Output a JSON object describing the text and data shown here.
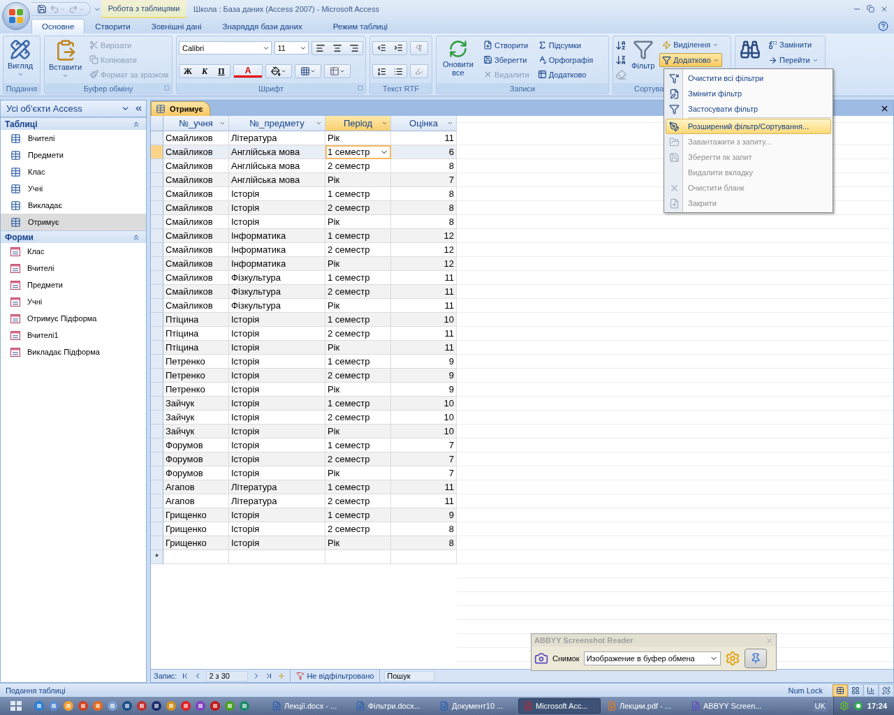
{
  "window": {
    "title": "Школа : База даних (Access 2007)  -  Microsoft Access",
    "context_group": "Робота з таблицями"
  },
  "ribbon_tabs": [
    {
      "label": "Основне",
      "selected": true,
      "kind": "main"
    },
    {
      "label": "Створити",
      "selected": false,
      "kind": "main"
    },
    {
      "label": "Зовнішні дані",
      "selected": false,
      "kind": "main"
    },
    {
      "label": "Знаряддя бази даних",
      "selected": false,
      "kind": "main"
    },
    {
      "label": "Режим таблиці",
      "selected": false,
      "kind": "context"
    }
  ],
  "ribbon": {
    "view": {
      "label": "Подання",
      "button": "Вигляд"
    },
    "clipboard": {
      "label": "Буфер обміну",
      "paste": "Вставити",
      "items": [
        {
          "label": "Вирізати",
          "disabled": true
        },
        {
          "label": "Копіювати",
          "disabled": true
        },
        {
          "label": "Формат за зразком",
          "disabled": true
        }
      ]
    },
    "font": {
      "label": "Шрифт",
      "font_name": "Calibri",
      "font_size": "11",
      "bold": "Ж",
      "italic": "К",
      "underline": "П",
      "font_color": "A"
    },
    "rtf": {
      "label": "Текст RTF"
    },
    "records": {
      "label": "Записи",
      "refresh": "Оновити все",
      "items": [
        {
          "label": "Створити",
          "disabled": false
        },
        {
          "label": "Зберегти",
          "disabled": false
        },
        {
          "label": "Видалити",
          "disabled": true
        },
        {
          "label": "Підсумки",
          "disabled": false
        },
        {
          "label": "Орфографія",
          "disabled": false
        },
        {
          "label": "Додатково",
          "disabled": false
        }
      ]
    },
    "sort_filter": {
      "label": "Сортува",
      "filter": "Фільтр",
      "items": [
        {
          "label": "Виділення",
          "selected": false
        },
        {
          "label": "Додатково",
          "selected": true
        }
      ]
    },
    "find": {
      "items": [
        "Замінити",
        "Перейти"
      ]
    }
  },
  "advanced_menu": [
    {
      "label": "Очистити всі фільтри",
      "disabled": false,
      "selected": false
    },
    {
      "label": "Змінити фільтр",
      "disabled": false,
      "selected": false
    },
    {
      "label": "Застосувати фільтр",
      "disabled": false,
      "selected": false
    },
    {
      "label": "Розширений фільтр/Сортування...",
      "disabled": false,
      "selected": true
    },
    {
      "label": "Завантажити з запиту...",
      "disabled": true,
      "selected": false
    },
    {
      "label": "Зберегти як запит",
      "disabled": true,
      "selected": false
    },
    {
      "label": "Видалити вкладку",
      "disabled": true,
      "selected": false
    },
    {
      "label": "Очистити бланк",
      "disabled": true,
      "selected": false
    },
    {
      "label": "Закрити",
      "disabled": true,
      "selected": false
    }
  ],
  "navigation": {
    "title": "Усі об'єкти Access",
    "groups": [
      {
        "label": "Таблиці",
        "kind": "table",
        "items": [
          {
            "label": "Вчителі",
            "selected": false
          },
          {
            "label": "Предмети",
            "selected": false
          },
          {
            "label": "Клас",
            "selected": false
          },
          {
            "label": "Учні",
            "selected": false
          },
          {
            "label": "Викладає",
            "selected": false
          },
          {
            "label": "Отримує",
            "selected": true
          }
        ]
      },
      {
        "label": "Форми",
        "kind": "form",
        "items": [
          {
            "label": "Клас",
            "selected": false
          },
          {
            "label": "Вчителі",
            "selected": false
          },
          {
            "label": "Предмети",
            "selected": false
          },
          {
            "label": "Учні",
            "selected": false
          },
          {
            "label": "Отримує Підформа",
            "selected": false
          },
          {
            "label": "Вчителі1",
            "selected": false
          },
          {
            "label": "Викладає Підформа",
            "selected": false
          }
        ]
      }
    ]
  },
  "document_tab": {
    "label": "Отримує"
  },
  "datasheet": {
    "columns": [
      {
        "label": "№_учня",
        "selected": false,
        "numeric": false
      },
      {
        "label": "№_предмету",
        "selected": false,
        "numeric": false
      },
      {
        "label": "Період",
        "selected": true,
        "numeric": false
      },
      {
        "label": "Оцінка",
        "selected": false,
        "numeric": true
      }
    ],
    "rows": [
      {
        "cells": [
          "Смайликов",
          "Література",
          "Рік",
          "11"
        ],
        "selected": false
      },
      {
        "cells": [
          "Смайликов",
          "Англійська мова",
          "1 семестр",
          "6"
        ],
        "selected": true
      },
      {
        "cells": [
          "Смайликов",
          "Англійська мова",
          "2 семестр",
          "8"
        ],
        "selected": false
      },
      {
        "cells": [
          "Смайликов",
          "Англійська мова",
          "Рік",
          "7"
        ],
        "selected": false
      },
      {
        "cells": [
          "Смайликов",
          "Історія",
          "1 семестр",
          "8"
        ],
        "selected": false
      },
      {
        "cells": [
          "Смайликов",
          "Історія",
          "2 семестр",
          "8"
        ],
        "selected": false
      },
      {
        "cells": [
          "Смайликов",
          "Історія",
          "Рік",
          "8"
        ],
        "selected": false
      },
      {
        "cells": [
          "Смайликов",
          "Інформатика",
          "1 семестр",
          "12"
        ],
        "selected": false
      },
      {
        "cells": [
          "Смайликов",
          "Інформатика",
          "2 семестр",
          "12"
        ],
        "selected": false
      },
      {
        "cells": [
          "Смайликов",
          "Інформатика",
          "Рік",
          "12"
        ],
        "selected": false
      },
      {
        "cells": [
          "Смайликов",
          "Фізкультура",
          "1 семестр",
          "11"
        ],
        "selected": false
      },
      {
        "cells": [
          "Смайликов",
          "Фізкультура",
          "2 семестр",
          "11"
        ],
        "selected": false
      },
      {
        "cells": [
          "Смайликов",
          "Фізкультура",
          "Рік",
          "11"
        ],
        "selected": false
      },
      {
        "cells": [
          "Птіцина",
          "Історія",
          "1 семестр",
          "10"
        ],
        "selected": false
      },
      {
        "cells": [
          "Птіцина",
          "Історія",
          "2 семестр",
          "11"
        ],
        "selected": false
      },
      {
        "cells": [
          "Птіцина",
          "Історія",
          "Рік",
          "11"
        ],
        "selected": false
      },
      {
        "cells": [
          "Петренко",
          "Історія",
          "1 семестр",
          "9"
        ],
        "selected": false
      },
      {
        "cells": [
          "Петренко",
          "Історія",
          "2 семестр",
          "9"
        ],
        "selected": false
      },
      {
        "cells": [
          "Петренко",
          "Історія",
          "Рік",
          "9"
        ],
        "selected": false
      },
      {
        "cells": [
          "Зайчук",
          "Історія",
          "1 семестр",
          "10"
        ],
        "selected": false
      },
      {
        "cells": [
          "Зайчук",
          "Історія",
          "2 семестр",
          "10"
        ],
        "selected": false
      },
      {
        "cells": [
          "Зайчук",
          "Історія",
          "Рік",
          "10"
        ],
        "selected": false
      },
      {
        "cells": [
          "Форумов",
          "Історія",
          "1 семестр",
          "7"
        ],
        "selected": false
      },
      {
        "cells": [
          "Форумов",
          "Історія",
          "2 семестр",
          "7"
        ],
        "selected": false
      },
      {
        "cells": [
          "Форумов",
          "Історія",
          "Рік",
          "7"
        ],
        "selected": false
      },
      {
        "cells": [
          "Агапов",
          "Література",
          "1 семестр",
          "11"
        ],
        "selected": false
      },
      {
        "cells": [
          "Агапов",
          "Література",
          "2 семестр",
          "11"
        ],
        "selected": false
      },
      {
        "cells": [
          "Грищенко",
          "Історія",
          "1 семестр",
          "9"
        ],
        "selected": false
      },
      {
        "cells": [
          "Грищенко",
          "Історія",
          "2 семестр",
          "8"
        ],
        "selected": false
      },
      {
        "cells": [
          "Грищенко",
          "Історія",
          "Рік",
          "8"
        ],
        "selected": false
      }
    ],
    "new_row_marker": "*"
  },
  "record_nav": {
    "label": "Запис:",
    "position": "2 з 30",
    "filter_status": "Не відфільтровано",
    "search_placeholder": "Пошук"
  },
  "status_bar": {
    "text": "Подання таблиці",
    "num_lock": "Num Lock",
    "views": [
      {
        "selected": true
      },
      {
        "selected": false
      },
      {
        "selected": false
      },
      {
        "selected": false
      }
    ]
  },
  "abbyy": {
    "title": "ABBYY Screenshot Reader",
    "snapshot": "Снимок",
    "mode": "Изображение в буфер обмена"
  },
  "taskbar": {
    "tasks": [
      {
        "label": "Лекції.docx - ...",
        "selected": false,
        "kind": "word"
      },
      {
        "label": "Фільтри.docx...",
        "selected": false,
        "kind": "word"
      },
      {
        "label": "Документ10 ...",
        "selected": false,
        "kind": "word"
      },
      {
        "label": "Microsoft Acc...",
        "selected": true,
        "kind": "access"
      },
      {
        "label": "Лекции.pdf - ...",
        "selected": false,
        "kind": "pdf"
      },
      {
        "label": "ABBYY Screen...",
        "selected": false,
        "kind": "abbyy"
      }
    ],
    "language": "UK",
    "clock": "17:24"
  }
}
